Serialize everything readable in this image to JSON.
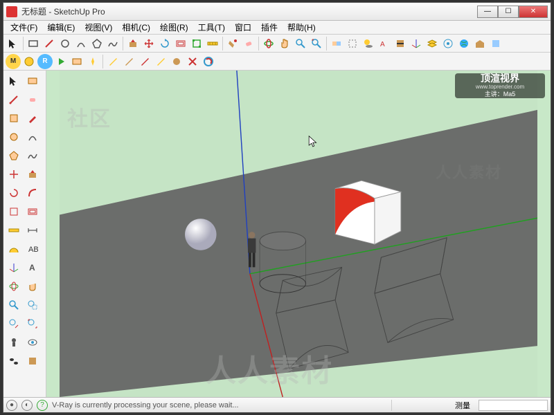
{
  "window": {
    "title": "无标题 - SketchUp Pro",
    "min": "—",
    "max": "☐",
    "close": "✕"
  },
  "menus": [
    "文件(F)",
    "编辑(E)",
    "视图(V)",
    "相机(C)",
    "绘图(R)",
    "工具(T)",
    "窗口",
    "插件",
    "帮助(H)"
  ],
  "watermark": {
    "brand": "顶渲视界",
    "url": "www.toprender.com",
    "lecturer": "主讲：Ma5"
  },
  "status": {
    "text": "V-Ray is currently processing your scene, please wait...",
    "measure_label": "测量"
  },
  "center_watermark": "人人素材"
}
